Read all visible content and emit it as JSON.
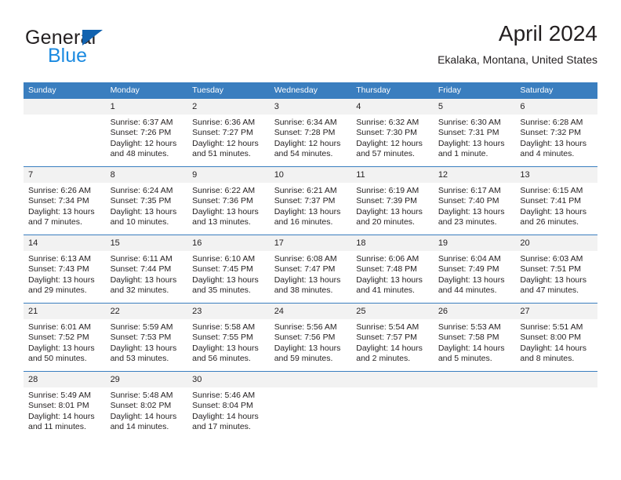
{
  "brand": {
    "name_part1": "General",
    "name_part2": "Blue",
    "triangle_color": "#1263b0",
    "blue_color": "#1b8ae0"
  },
  "header": {
    "title": "April 2024",
    "subtitle": "Ekalaka, Montana, United States"
  },
  "theme": {
    "header_bg": "#3a7ebf",
    "date_band_bg": "#f2f2f2",
    "text_color": "#231f20",
    "row_divider": "#3a7ebf"
  },
  "weekdays": [
    "Sunday",
    "Monday",
    "Tuesday",
    "Wednesday",
    "Thursday",
    "Friday",
    "Saturday"
  ],
  "weeks": [
    [
      {
        "day": "",
        "empty": true,
        "sunrise": "",
        "sunset": "",
        "daylight1": "",
        "daylight2": ""
      },
      {
        "day": "1",
        "sunrise": "Sunrise: 6:37 AM",
        "sunset": "Sunset: 7:26 PM",
        "daylight1": "Daylight: 12 hours",
        "daylight2": "and 48 minutes."
      },
      {
        "day": "2",
        "sunrise": "Sunrise: 6:36 AM",
        "sunset": "Sunset: 7:27 PM",
        "daylight1": "Daylight: 12 hours",
        "daylight2": "and 51 minutes."
      },
      {
        "day": "3",
        "sunrise": "Sunrise: 6:34 AM",
        "sunset": "Sunset: 7:28 PM",
        "daylight1": "Daylight: 12 hours",
        "daylight2": "and 54 minutes."
      },
      {
        "day": "4",
        "sunrise": "Sunrise: 6:32 AM",
        "sunset": "Sunset: 7:30 PM",
        "daylight1": "Daylight: 12 hours",
        "daylight2": "and 57 minutes."
      },
      {
        "day": "5",
        "sunrise": "Sunrise: 6:30 AM",
        "sunset": "Sunset: 7:31 PM",
        "daylight1": "Daylight: 13 hours",
        "daylight2": "and 1 minute."
      },
      {
        "day": "6",
        "sunrise": "Sunrise: 6:28 AM",
        "sunset": "Sunset: 7:32 PM",
        "daylight1": "Daylight: 13 hours",
        "daylight2": "and 4 minutes."
      }
    ],
    [
      {
        "day": "7",
        "sunrise": "Sunrise: 6:26 AM",
        "sunset": "Sunset: 7:34 PM",
        "daylight1": "Daylight: 13 hours",
        "daylight2": "and 7 minutes."
      },
      {
        "day": "8",
        "sunrise": "Sunrise: 6:24 AM",
        "sunset": "Sunset: 7:35 PM",
        "daylight1": "Daylight: 13 hours",
        "daylight2": "and 10 minutes."
      },
      {
        "day": "9",
        "sunrise": "Sunrise: 6:22 AM",
        "sunset": "Sunset: 7:36 PM",
        "daylight1": "Daylight: 13 hours",
        "daylight2": "and 13 minutes."
      },
      {
        "day": "10",
        "sunrise": "Sunrise: 6:21 AM",
        "sunset": "Sunset: 7:37 PM",
        "daylight1": "Daylight: 13 hours",
        "daylight2": "and 16 minutes."
      },
      {
        "day": "11",
        "sunrise": "Sunrise: 6:19 AM",
        "sunset": "Sunset: 7:39 PM",
        "daylight1": "Daylight: 13 hours",
        "daylight2": "and 20 minutes."
      },
      {
        "day": "12",
        "sunrise": "Sunrise: 6:17 AM",
        "sunset": "Sunset: 7:40 PM",
        "daylight1": "Daylight: 13 hours",
        "daylight2": "and 23 minutes."
      },
      {
        "day": "13",
        "sunrise": "Sunrise: 6:15 AM",
        "sunset": "Sunset: 7:41 PM",
        "daylight1": "Daylight: 13 hours",
        "daylight2": "and 26 minutes."
      }
    ],
    [
      {
        "day": "14",
        "sunrise": "Sunrise: 6:13 AM",
        "sunset": "Sunset: 7:43 PM",
        "daylight1": "Daylight: 13 hours",
        "daylight2": "and 29 minutes."
      },
      {
        "day": "15",
        "sunrise": "Sunrise: 6:11 AM",
        "sunset": "Sunset: 7:44 PM",
        "daylight1": "Daylight: 13 hours",
        "daylight2": "and 32 minutes."
      },
      {
        "day": "16",
        "sunrise": "Sunrise: 6:10 AM",
        "sunset": "Sunset: 7:45 PM",
        "daylight1": "Daylight: 13 hours",
        "daylight2": "and 35 minutes."
      },
      {
        "day": "17",
        "sunrise": "Sunrise: 6:08 AM",
        "sunset": "Sunset: 7:47 PM",
        "daylight1": "Daylight: 13 hours",
        "daylight2": "and 38 minutes."
      },
      {
        "day": "18",
        "sunrise": "Sunrise: 6:06 AM",
        "sunset": "Sunset: 7:48 PM",
        "daylight1": "Daylight: 13 hours",
        "daylight2": "and 41 minutes."
      },
      {
        "day": "19",
        "sunrise": "Sunrise: 6:04 AM",
        "sunset": "Sunset: 7:49 PM",
        "daylight1": "Daylight: 13 hours",
        "daylight2": "and 44 minutes."
      },
      {
        "day": "20",
        "sunrise": "Sunrise: 6:03 AM",
        "sunset": "Sunset: 7:51 PM",
        "daylight1": "Daylight: 13 hours",
        "daylight2": "and 47 minutes."
      }
    ],
    [
      {
        "day": "21",
        "sunrise": "Sunrise: 6:01 AM",
        "sunset": "Sunset: 7:52 PM",
        "daylight1": "Daylight: 13 hours",
        "daylight2": "and 50 minutes."
      },
      {
        "day": "22",
        "sunrise": "Sunrise: 5:59 AM",
        "sunset": "Sunset: 7:53 PM",
        "daylight1": "Daylight: 13 hours",
        "daylight2": "and 53 minutes."
      },
      {
        "day": "23",
        "sunrise": "Sunrise: 5:58 AM",
        "sunset": "Sunset: 7:55 PM",
        "daylight1": "Daylight: 13 hours",
        "daylight2": "and 56 minutes."
      },
      {
        "day": "24",
        "sunrise": "Sunrise: 5:56 AM",
        "sunset": "Sunset: 7:56 PM",
        "daylight1": "Daylight: 13 hours",
        "daylight2": "and 59 minutes."
      },
      {
        "day": "25",
        "sunrise": "Sunrise: 5:54 AM",
        "sunset": "Sunset: 7:57 PM",
        "daylight1": "Daylight: 14 hours",
        "daylight2": "and 2 minutes."
      },
      {
        "day": "26",
        "sunrise": "Sunrise: 5:53 AM",
        "sunset": "Sunset: 7:58 PM",
        "daylight1": "Daylight: 14 hours",
        "daylight2": "and 5 minutes."
      },
      {
        "day": "27",
        "sunrise": "Sunrise: 5:51 AM",
        "sunset": "Sunset: 8:00 PM",
        "daylight1": "Daylight: 14 hours",
        "daylight2": "and 8 minutes."
      }
    ],
    [
      {
        "day": "28",
        "sunrise": "Sunrise: 5:49 AM",
        "sunset": "Sunset: 8:01 PM",
        "daylight1": "Daylight: 14 hours",
        "daylight2": "and 11 minutes."
      },
      {
        "day": "29",
        "sunrise": "Sunrise: 5:48 AM",
        "sunset": "Sunset: 8:02 PM",
        "daylight1": "Daylight: 14 hours",
        "daylight2": "and 14 minutes."
      },
      {
        "day": "30",
        "sunrise": "Sunrise: 5:46 AM",
        "sunset": "Sunset: 8:04 PM",
        "daylight1": "Daylight: 14 hours",
        "daylight2": "and 17 minutes."
      },
      {
        "day": "",
        "empty": true,
        "sunrise": "",
        "sunset": "",
        "daylight1": "",
        "daylight2": ""
      },
      {
        "day": "",
        "empty": true,
        "sunrise": "",
        "sunset": "",
        "daylight1": "",
        "daylight2": ""
      },
      {
        "day": "",
        "empty": true,
        "sunrise": "",
        "sunset": "",
        "daylight1": "",
        "daylight2": ""
      },
      {
        "day": "",
        "empty": true,
        "sunrise": "",
        "sunset": "",
        "daylight1": "",
        "daylight2": ""
      }
    ]
  ]
}
